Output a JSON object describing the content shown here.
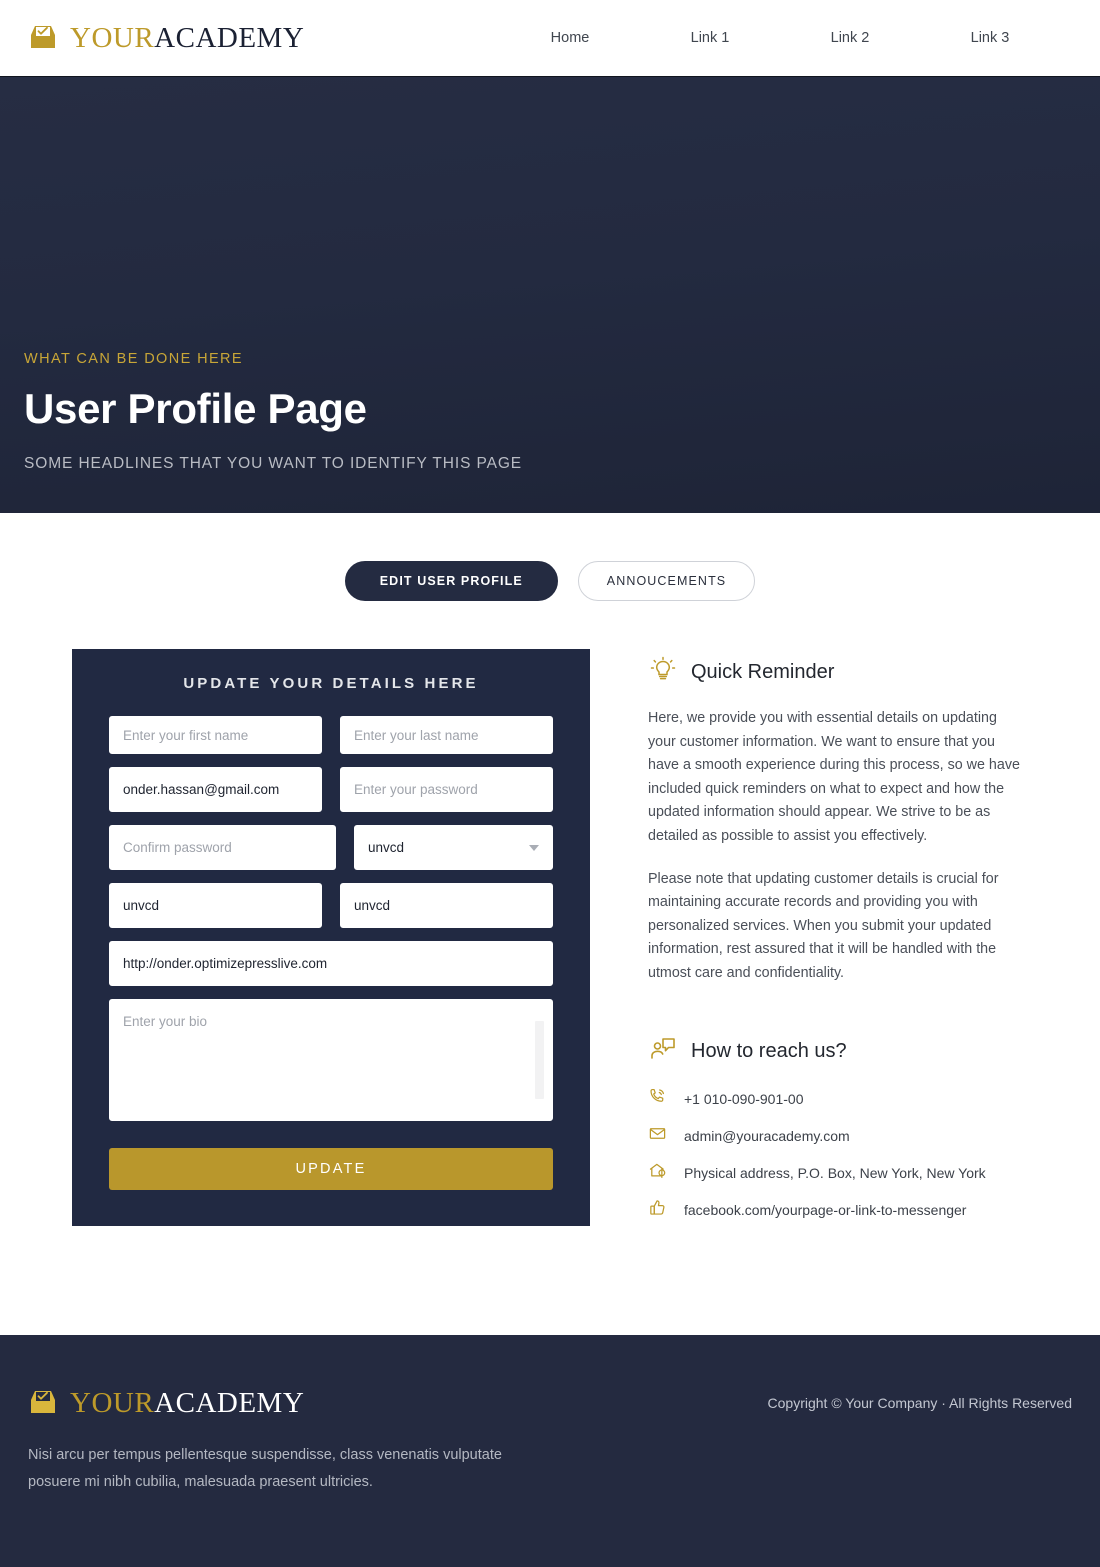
{
  "brand": {
    "icon": "inbox-check-icon",
    "text_primary": "YOUR",
    "text_secondary": "ACADEMY"
  },
  "nav": {
    "items": [
      {
        "label": "Home"
      },
      {
        "label": "Link 1"
      },
      {
        "label": "Link 2"
      },
      {
        "label": "Link 3"
      }
    ]
  },
  "hero": {
    "eyebrow": "WHAT CAN BE DONE HERE",
    "title": "User Profile Page",
    "subtitle": "SOME HEADLINES THAT YOU WANT TO IDENTIFY THIS PAGE"
  },
  "tabs": [
    {
      "label": "EDIT  USER PROFILE",
      "active": true
    },
    {
      "label": "ANNOUCEMENTS",
      "active": false
    }
  ],
  "form": {
    "title": "UPDATE YOUR DETAILS HERE",
    "first_name": {
      "value": "",
      "placeholder": "Enter your first name"
    },
    "last_name": {
      "value": "",
      "placeholder": "Enter your last name"
    },
    "email": {
      "value": "onder.hassan@gmail.com",
      "placeholder": ""
    },
    "password": {
      "value": "",
      "placeholder": "Enter your password"
    },
    "confirm_password": {
      "value": "",
      "placeholder": "Confirm password"
    },
    "select": {
      "value": "unvcd"
    },
    "extra_one": {
      "value": "unvcd",
      "placeholder": ""
    },
    "extra_two": {
      "value": "unvcd",
      "placeholder": ""
    },
    "website": {
      "value": "http://onder.optimizepresslive.com",
      "placeholder": ""
    },
    "bio": {
      "value": "",
      "placeholder": "Enter your bio"
    },
    "submit_label": "UPDATE"
  },
  "reminder": {
    "icon": "lightbulb-icon",
    "heading": "Quick Reminder",
    "paragraph_one": "Here, we provide you with essential details on updating your customer information. We want to ensure that you have a smooth experience during this process, so we have included quick reminders on what to expect and how the updated information should appear. We strive to be as detailed as possible to assist you effectively.",
    "paragraph_two": "Please note that updating customer details is crucial for maintaining accurate records and providing you with personalized services. When you submit your updated information, rest assured that it will be handled with the utmost care and confidentiality."
  },
  "reach": {
    "icon": "person-speech-bubble-icon",
    "heading": "How to reach us?",
    "items": [
      {
        "icon": "phone-icon",
        "text": "+1 010-090-901-00"
      },
      {
        "icon": "envelope-icon",
        "text": "admin@youracademy.com"
      },
      {
        "icon": "address-pin-icon",
        "text": "Physical address, P.O. Box, New York, New York"
      },
      {
        "icon": "thumbs-up-icon",
        "text": "facebook.com/yourpage-or-link-to-messenger"
      }
    ]
  },
  "footer": {
    "tagline": "Nisi arcu per tempus pellentesque suspendisse, class venenatis vulputate posuere mi nibh cubilia, malesuada praesent ultricies.",
    "copyright": "Copyright © Your Company · All Rights Reserved"
  },
  "colors": {
    "gold": "#b9972c",
    "navy": "#242a40",
    "card_navy": "#212942",
    "hero_navy": "#232a40"
  }
}
